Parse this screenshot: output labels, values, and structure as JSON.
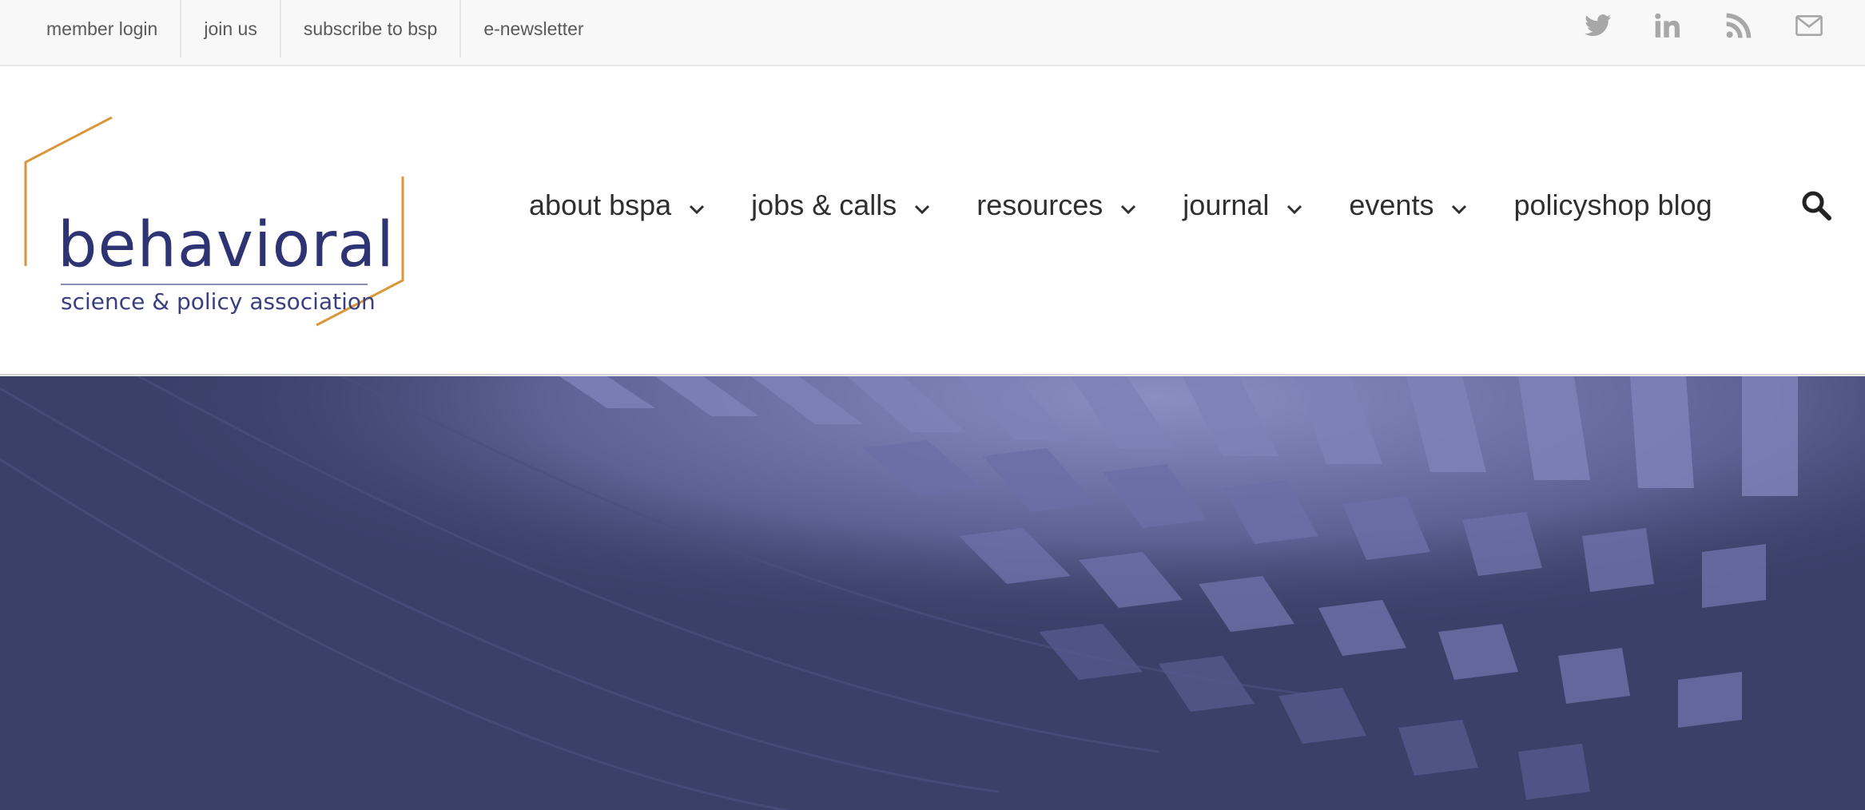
{
  "topbar": {
    "links": [
      {
        "label": "member login"
      },
      {
        "label": "join us"
      },
      {
        "label": "subscribe to bsp"
      },
      {
        "label": "e-newsletter"
      }
    ],
    "social": [
      {
        "icon": "twitter-icon"
      },
      {
        "icon": "linkedin-icon"
      },
      {
        "icon": "rss-icon"
      },
      {
        "icon": "email-icon"
      }
    ],
    "icon_color": "#a7a7a7"
  },
  "logo": {
    "main": "behavioral",
    "sub": "science & policy association",
    "text_color": "#2d3373",
    "accent_color": "#d9963a"
  },
  "nav": {
    "items": [
      {
        "label": "about bspa",
        "dropdown": true
      },
      {
        "label": "jobs & calls",
        "dropdown": true
      },
      {
        "label": "resources",
        "dropdown": true
      },
      {
        "label": "journal",
        "dropdown": true
      },
      {
        "label": "events",
        "dropdown": true
      },
      {
        "label": "policyshop blog",
        "dropdown": false
      }
    ],
    "search_icon": "search-icon"
  },
  "hero": {
    "image": "hero-banner-image",
    "tint_color": "#3b4069"
  }
}
